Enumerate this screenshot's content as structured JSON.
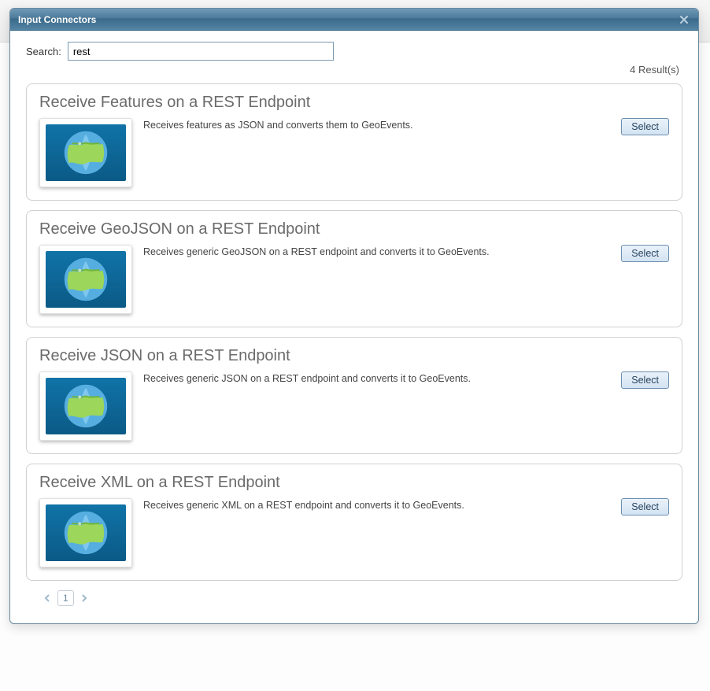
{
  "dialog": {
    "title": "Input Connectors"
  },
  "search": {
    "label": "Search:",
    "value": "rest"
  },
  "results": {
    "count_text": "4 Result(s)"
  },
  "select_label": "Select",
  "connectors": [
    {
      "title": "Receive Features on a REST Endpoint",
      "desc": "Receives features as JSON and converts them to GeoEvents."
    },
    {
      "title": "Receive GeoJSON on a REST Endpoint",
      "desc": "Receives generic GeoJSON on a REST endpoint and converts it to GeoEvents."
    },
    {
      "title": "Receive JSON on a REST Endpoint",
      "desc": "Receives generic JSON on a REST endpoint and converts it to GeoEvents."
    },
    {
      "title": "Receive XML on a REST Endpoint",
      "desc": "Receives generic XML on a REST endpoint and converts it to GeoEvents."
    }
  ],
  "pager": {
    "current": "1"
  }
}
